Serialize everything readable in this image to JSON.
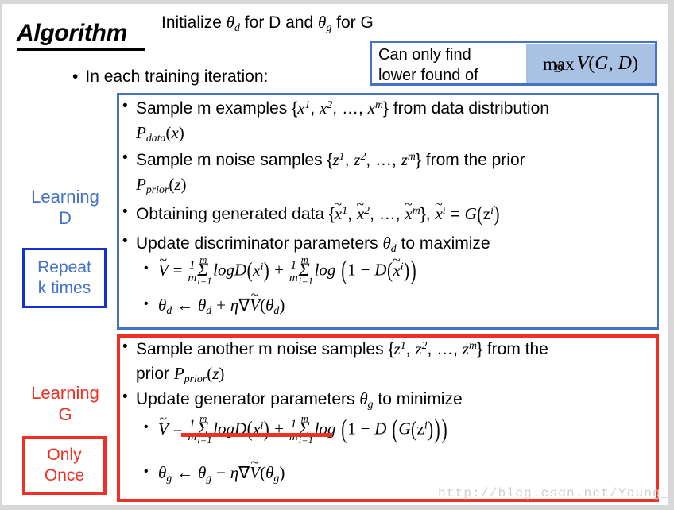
{
  "title": "Algorithm",
  "init_line": "Initialize θ_d for D and θ_g for G",
  "iteration_line": "In each training iteration:",
  "callout": {
    "line1": "Can only find",
    "line2": "lower found of",
    "formula": "max_D V(G,D)",
    "formula_op": "max",
    "formula_sub": "D",
    "formula_body": "V(G,D)",
    "border_color": "#4472C4",
    "highlight_color": "#A9C2E3"
  },
  "learning_d": {
    "label_line1": "Learning",
    "label_line2": "D",
    "badge_line1": "Repeat",
    "badge_line2": "k times",
    "border_color": "#4472C4",
    "badge_border_color": "#1432D2",
    "text_color": "#4472C4",
    "bullets": [
      {
        "text": "Sample m examples {x^1, x^2, …, x^m} from data distribution",
        "continuation": "P_data(x)"
      },
      {
        "text": "Sample m noise samples {z^1, z^2, …, z^m} from the prior",
        "continuation": "P_prior(z)"
      },
      {
        "text": "Obtaining generated data {x̃^1, x̃^2, …, x̃^m}, x̃^i = G(z^i)",
        "continuation": ""
      },
      {
        "text": "Update discriminator parameters θ_d to maximize",
        "continuation": ""
      }
    ],
    "equations": [
      "Ṽ = 1/m Σ_{i=1}^{m} logD(x^i) + 1/m Σ_{i=1}^{m} log(1 − D(x̃^i))",
      "θ_d ← θ_d + η∇Ṽ(θ_d)"
    ]
  },
  "learning_g": {
    "label_line1": "Learning",
    "label_line2": "G",
    "badge_line1": "Only",
    "badge_line2": "Once",
    "border_color": "#EE3124",
    "text_color": "#EE3124",
    "bullets": [
      {
        "text": "Sample another m noise samples {z^1, z^2, …, z^m} from the",
        "continuation": "prior P_prior(z)"
      },
      {
        "text": "Update generator parameters θ_g to minimize",
        "continuation": ""
      }
    ],
    "equations": [
      "Ṽ = 1/m Σ_{i=1}^{m} logD(x^i) + 1/m Σ_{i=1}^{m} log(1 − D(G(z^i)))",
      "θ_g ← θ_g − η∇Ṽ(θ_g)"
    ],
    "struck_term": "1/m Σ_{i=1}^{m} logD(x^i)"
  },
  "watermark": "http://blog.csdn.net/Young_Gy",
  "bullet_glyph": "•"
}
